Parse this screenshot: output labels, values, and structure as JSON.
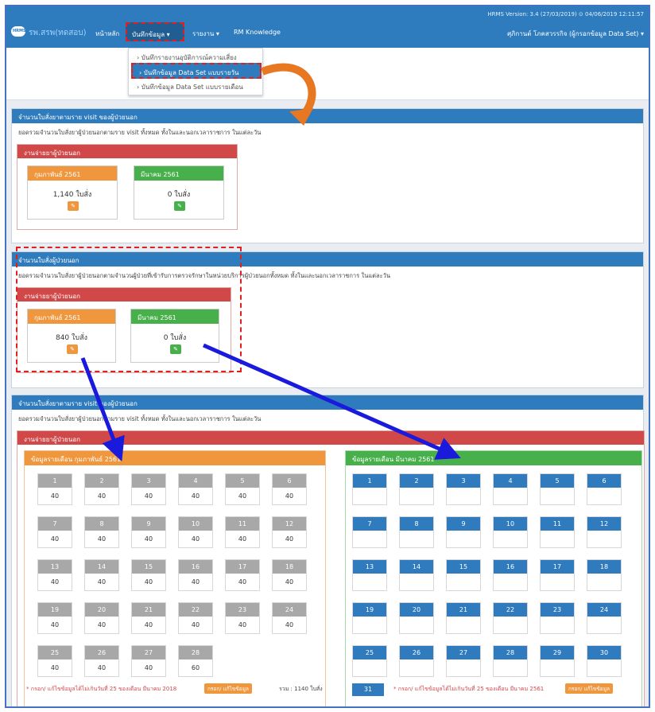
{
  "navbar": {
    "brand": "รพ.สรพ(ทดสอบ)",
    "home": "หน้าหลัก",
    "record_menu": "บันทึกข้อมูล ▾",
    "report_menu": "รายงาน ▾",
    "rm_knowledge": "RM Knowledge",
    "version": "HRMS Version: 3.4 (27/03/2019) ⊙ 04/06/2019 12:11:57",
    "user": "ศุภิกานต์ โภคสวรรกิจ (ผู้กรอกข้อมูล Data Set) ▾"
  },
  "dropdown": {
    "items": [
      "› บันทึกรายงานอุบัติการณ์ความเสี่ยง",
      "› บันทึกข้อมูล Data Set แบบรายวัน",
      "› บันทึกข้อมูล Data Set แบบรายเดือน"
    ]
  },
  "panel1": {
    "title": "จำนวนใบสั่งยาตามราย visit ของผู้ป่วยนอก",
    "desc": "ยอดรวมจำนวนใบสั่งยาผู้ป่วยนอกตามราย visit ทั้งหมด ทั้งในและนอกเวลาราชการ ในแต่ละวัน",
    "group": "งานจ่ายยาผู้ป่วยนอก",
    "card1": {
      "title": "กุมภาพันธ์ 2561",
      "count": "1,140 ใบสั่ง"
    },
    "card2": {
      "title": "มีนาคม 2561",
      "count": "0 ใบสั่ง"
    }
  },
  "panel2": {
    "title": "จำนวนใบสั่งผู้ป่วยนอก",
    "desc": "ยอดรวมจำนวนใบสั่งยาผู้ป่วยนอกตามจำนวนผู้ป่วยที่เข้ารับการตรวจรักษาในหน่วยบริการผู้ป่วยนอกทั้งหมด ทั้งในและนอกเวลาราชการ ในแต่ละวัน",
    "group": "งานจ่ายยาผู้ป่วยนอก",
    "card1": {
      "title": "กุมภาพันธ์ 2561",
      "count": "840 ใบสั่ง"
    },
    "card2": {
      "title": "มีนาคม 2561",
      "count": "0 ใบสั่ง"
    }
  },
  "panel3": {
    "title": "จำนวนใบสั่งยาตามราย visit ของผู้ป่วยนอก",
    "desc": "ยอดรวมจำนวนใบสั่งยาผู้ป่วยนอกตามราย visit ทั้งหมด ทั้งในและนอกเวลาราชการ ในแต่ละวัน",
    "group": "งานจ่ายยาผู้ป่วยนอก",
    "feb": {
      "title": "ข้อมูลรายเดือน กุมภาพันธ์ 2561",
      "days": [
        {
          "d": "1",
          "v": "40"
        },
        {
          "d": "2",
          "v": "40"
        },
        {
          "d": "3",
          "v": "40"
        },
        {
          "d": "4",
          "v": "40"
        },
        {
          "d": "5",
          "v": "40"
        },
        {
          "d": "6",
          "v": "40"
        },
        {
          "d": "7",
          "v": "40"
        },
        {
          "d": "8",
          "v": "40"
        },
        {
          "d": "9",
          "v": "40"
        },
        {
          "d": "10",
          "v": "40"
        },
        {
          "d": "11",
          "v": "40"
        },
        {
          "d": "12",
          "v": "40"
        },
        {
          "d": "13",
          "v": "40"
        },
        {
          "d": "14",
          "v": "40"
        },
        {
          "d": "15",
          "v": "40"
        },
        {
          "d": "16",
          "v": "40"
        },
        {
          "d": "17",
          "v": "40"
        },
        {
          "d": "18",
          "v": "40"
        },
        {
          "d": "19",
          "v": "40"
        },
        {
          "d": "20",
          "v": "40"
        },
        {
          "d": "21",
          "v": "40"
        },
        {
          "d": "22",
          "v": "40"
        },
        {
          "d": "23",
          "v": "40"
        },
        {
          "d": "24",
          "v": "40"
        },
        {
          "d": "25",
          "v": "40"
        },
        {
          "d": "26",
          "v": "40"
        },
        {
          "d": "27",
          "v": "40"
        },
        {
          "d": "28",
          "v": "60"
        }
      ],
      "note": "* กรอก/ แก้ไขข้อมูลได้ไม่เกินวันที่ 25 ของเดือน มีนาคม 2018",
      "button": "กรอก/ แก้ไขข้อมูล",
      "total": "รวม : 1140 ใบสั่ง"
    },
    "mar": {
      "title": "ข้อมูลรายเดือน มีนาคม 2561",
      "days": [
        "1",
        "2",
        "3",
        "4",
        "5",
        "6",
        "7",
        "8",
        "9",
        "10",
        "11",
        "12",
        "13",
        "14",
        "15",
        "16",
        "17",
        "18",
        "19",
        "20",
        "21",
        "22",
        "23",
        "24",
        "25",
        "26",
        "27",
        "28",
        "29",
        "30"
      ],
      "last_day": "31",
      "note": "* กรอก/ แก้ไขข้อมูลได้ไม่เกินวันที่ 25 ของเดือน มีนาคม 2561",
      "button": "กรอก/ แก้ไขข้อมูล"
    }
  },
  "colors": {
    "primary": "#2e7bbd",
    "danger": "#d04848",
    "orange": "#f0963c",
    "green": "#47b04a",
    "annotation_red": "#e02020",
    "arrow_blue": "#1a1adc",
    "arrow_orange": "#e87722"
  }
}
